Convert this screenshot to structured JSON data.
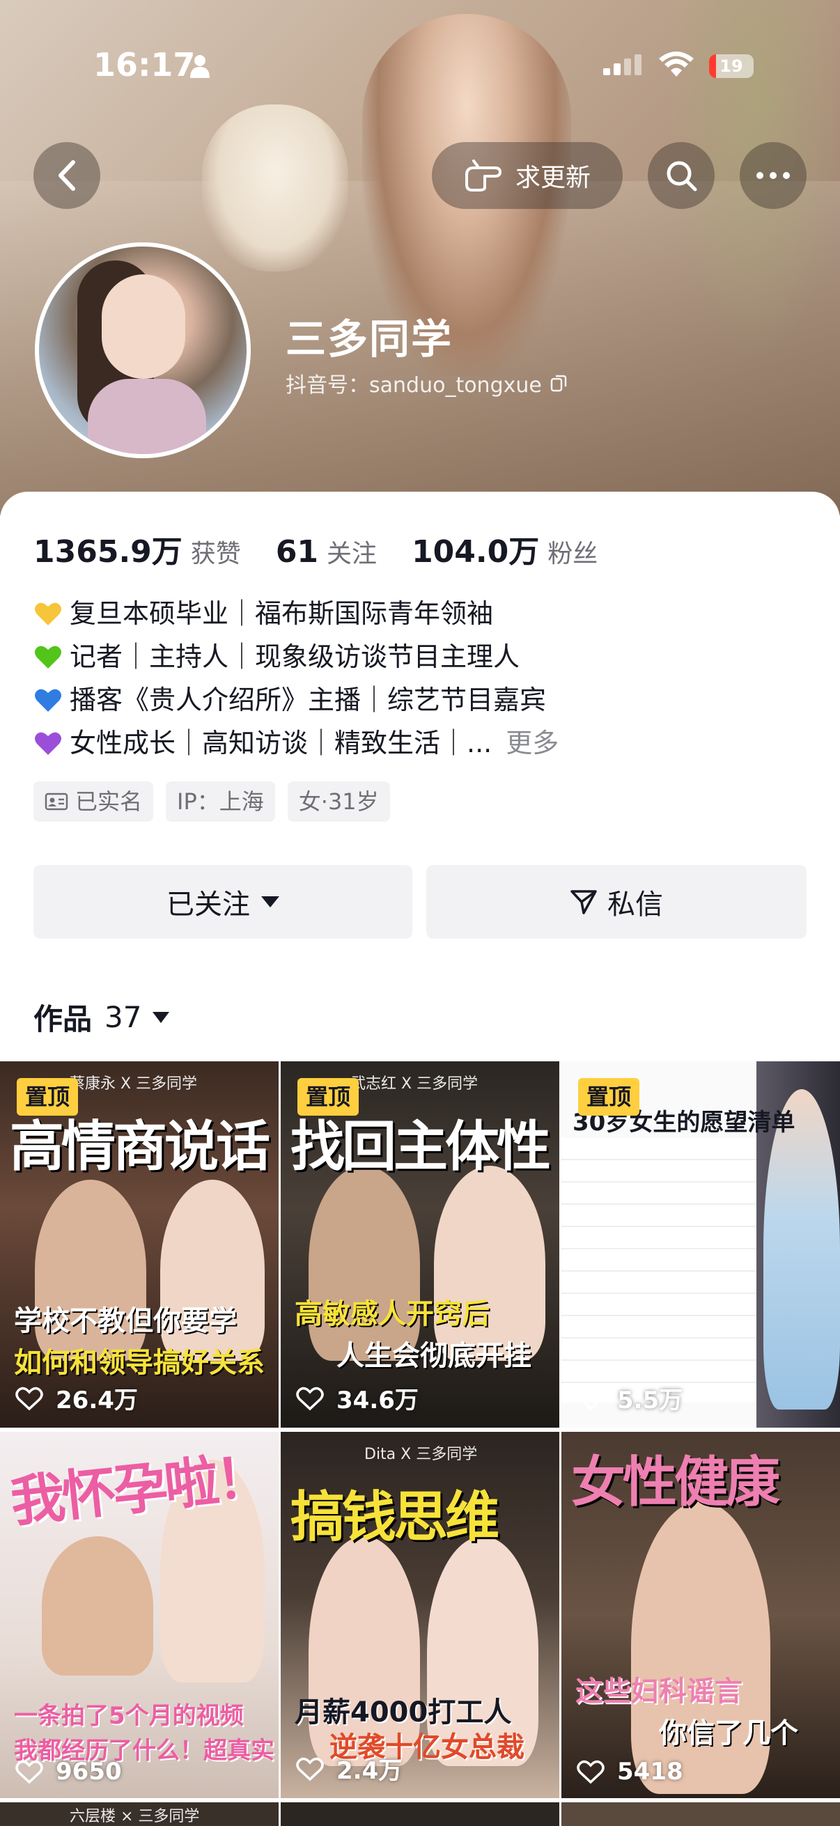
{
  "status_bar": {
    "time": "16:17",
    "battery": "19"
  },
  "header": {
    "request_update_label": "求更新"
  },
  "profile": {
    "name": "三多同学",
    "douyin_id": "抖音号：sanduo_tongxue"
  },
  "stats": [
    {
      "value": "1365.9万",
      "label": "获赞"
    },
    {
      "value": "61",
      "label": "关注"
    },
    {
      "value": "104.0万",
      "label": "粉丝"
    }
  ],
  "bio": [
    {
      "heart_color": "#f7c53a",
      "text": "复旦本硕毕业｜福布斯国际青年领袖"
    },
    {
      "heart_color": "#52c41a",
      "text": "记者｜主持人｜现象级访谈节目主理人"
    },
    {
      "heart_color": "#2f7de1",
      "text": "播客《贵人介绍所》主播｜综艺节目嘉宾"
    },
    {
      "heart_color": "#9b4fd9",
      "text": "女性成长｜高知访谈｜精致生活｜..."
    }
  ],
  "bio_more": "更多",
  "tags": [
    "已实名",
    "IP：上海",
    "女·31岁"
  ],
  "actions": {
    "follow_label": "已关注",
    "message_label": "私信"
  },
  "works": {
    "label": "作品",
    "count": "37"
  },
  "videos": [
    {
      "pinned": "置顶",
      "top_caption": "蔡康永 X 三多同学",
      "title": "高情商说话",
      "sub1": "学校不教但你要学",
      "sub2": "如何和领导搞好关系",
      "likes": "26.4万"
    },
    {
      "pinned": "置顶",
      "top_caption": "武志红 X 三多同学",
      "title": "找回主体性",
      "sub1": "高敏感人开窍后",
      "sub2": "人生会彻底开挂",
      "likes": "34.6万"
    },
    {
      "pinned": "置顶",
      "top_caption": "",
      "title": "30岁女生的愿望清单",
      "sub1": "",
      "sub2": "",
      "likes": "5.5万"
    },
    {
      "pinned": "",
      "top_caption": "",
      "title": "我怀孕啦！",
      "sub1": "一条拍了5个月的视频",
      "sub2": "我都经历了什么！超真实",
      "likes": "9650"
    },
    {
      "pinned": "",
      "top_caption": "Dita X 三多同学",
      "title": "搞钱思维",
      "sub1": "月薪4000打工人",
      "sub2": "逆袭十亿女总裁",
      "likes": "2.4万"
    },
    {
      "pinned": "",
      "top_caption": "",
      "title": "女性健康",
      "sub1": "这些妇科谣言",
      "sub2": "你信了几个",
      "likes": "5418"
    }
  ],
  "next_row_captions": [
    "六层楼 × 三多同学"
  ]
}
